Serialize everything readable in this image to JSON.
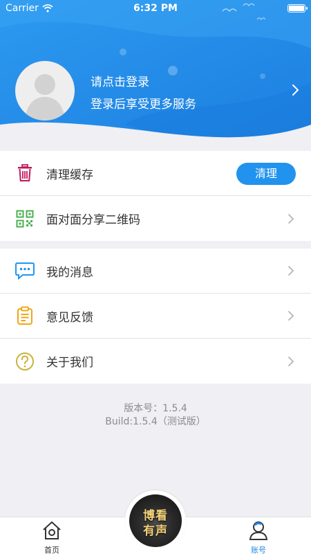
{
  "status_bar": {
    "carrier": "Carrier",
    "time": "6:32 PM"
  },
  "header": {
    "login_title": "请点击登录",
    "login_subtitle": "登录后享受更多服务",
    "avatar_icon": "user-silhouette-icon"
  },
  "section1": [
    {
      "label": "清理缓存",
      "icon": "trash-icon",
      "action_label": "清理"
    },
    {
      "label": "面对面分享二维码",
      "icon": "qrcode-icon"
    }
  ],
  "section2": [
    {
      "label": "我的消息",
      "icon": "message-icon"
    },
    {
      "label": "意见反馈",
      "icon": "clipboard-icon"
    },
    {
      "label": "关于我们",
      "icon": "question-icon"
    }
  ],
  "version": {
    "line1": "版本号：1.5.4",
    "line2": "Build:1.5.4（测试版）"
  },
  "tabbar": {
    "home_label": "首页",
    "account_label": "账号",
    "center_line1": "博看",
    "center_line2": "有声"
  },
  "colors": {
    "accent": "#2193ee",
    "tab_active": "#1e88e5",
    "tab_inactive": "#333333",
    "trash": "#c2185b",
    "qrcode": "#4caf50",
    "message": "#2196f3",
    "clipboard": "#f2a516",
    "question": "#c9b43b"
  }
}
